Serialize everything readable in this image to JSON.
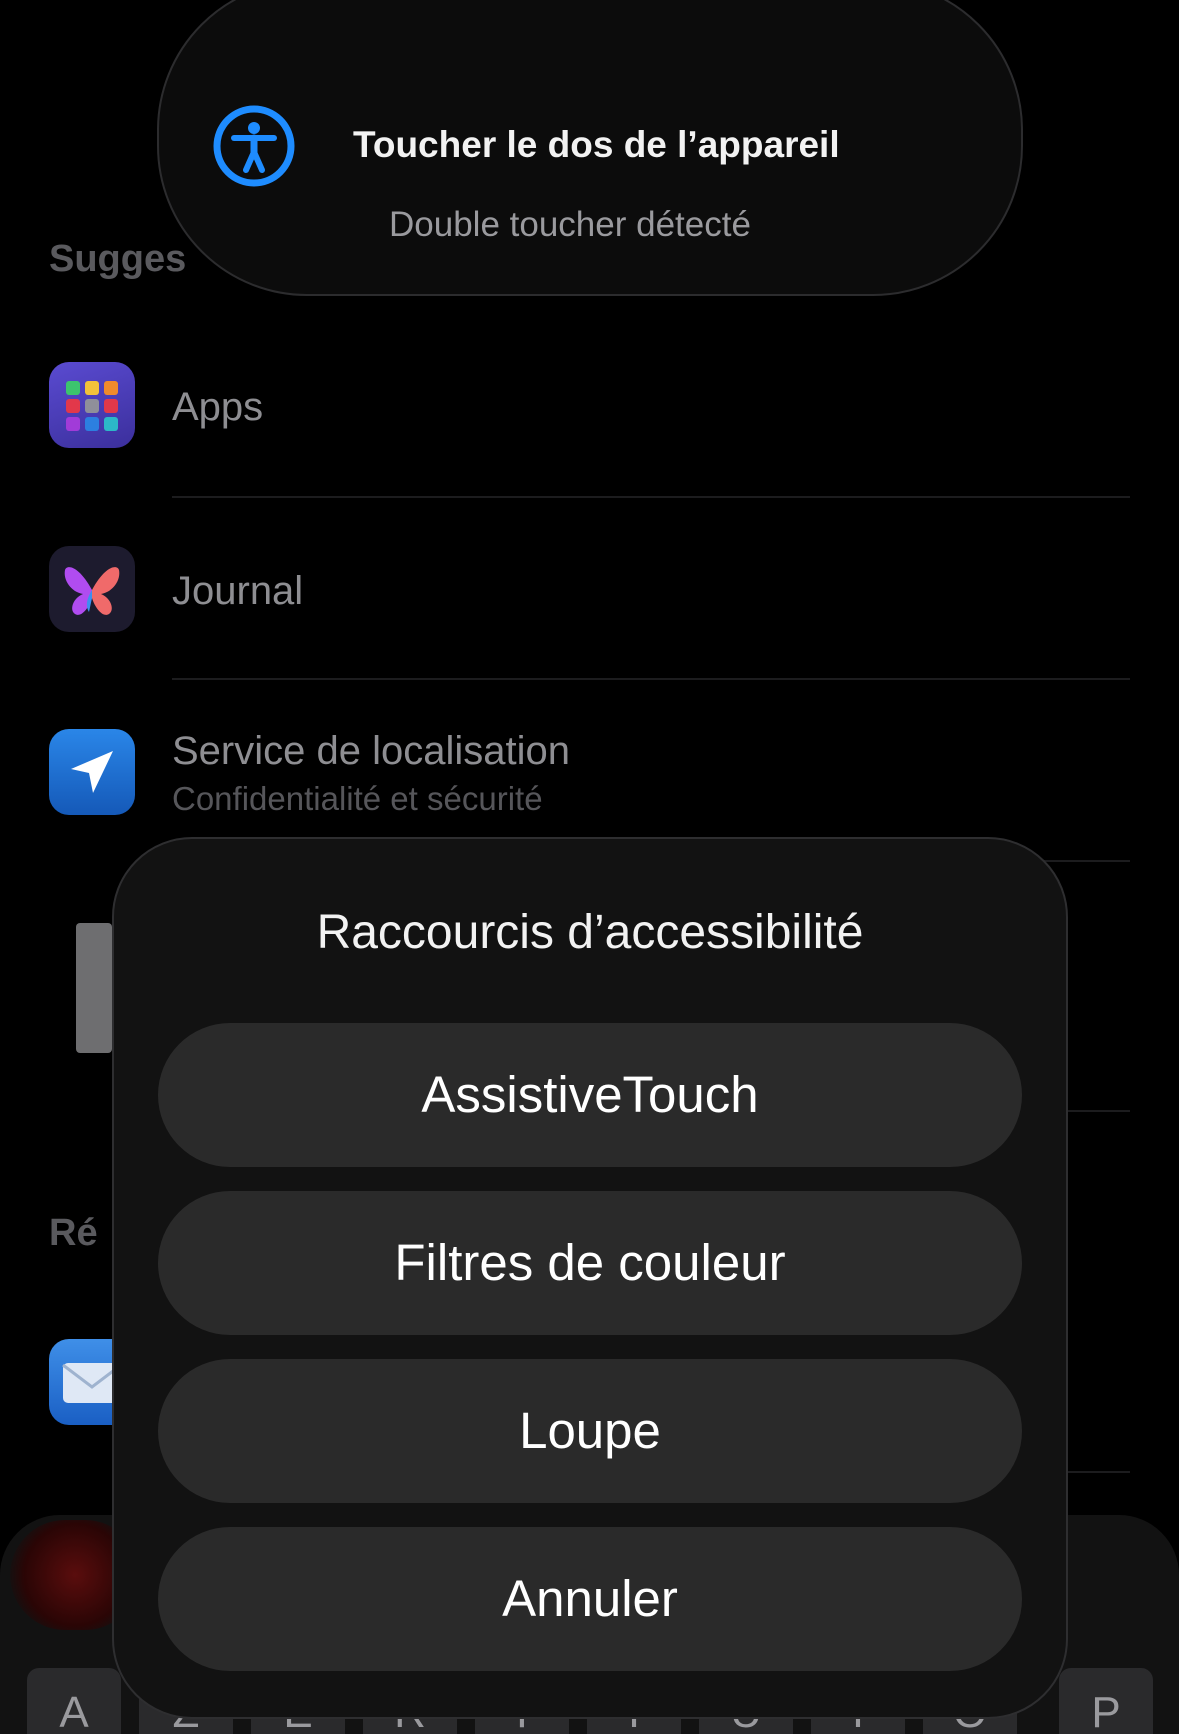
{
  "banner": {
    "title": "Toucher le dos de l’appareil",
    "subtitle": "Double toucher détecté",
    "icon": "accessibility-icon",
    "icon_color": "#1e8cff"
  },
  "background_list": {
    "section_suggestions": "Sugges",
    "section_recent": "Ré",
    "items": [
      {
        "title": "Apps",
        "icon": "apps-grid-icon"
      },
      {
        "title": "Journal",
        "icon": "journal-butterfly-icon"
      },
      {
        "title": "Service de localisation",
        "subtitle": "Confidentialité et sécurité",
        "icon": "location-arrow-icon"
      }
    ],
    "mail_icon": "mail-icon"
  },
  "sheet": {
    "title": "Raccourcis d’accessibilité",
    "buttons": [
      {
        "label": "AssistiveTouch"
      },
      {
        "label": "Filtres de couleur"
      },
      {
        "label": "Loupe"
      },
      {
        "label": "Annuler"
      }
    ]
  },
  "keyboard": {
    "keys": [
      "A",
      "Z",
      "E",
      "R",
      "T",
      "Y",
      "U",
      "I",
      "O",
      "P"
    ]
  }
}
